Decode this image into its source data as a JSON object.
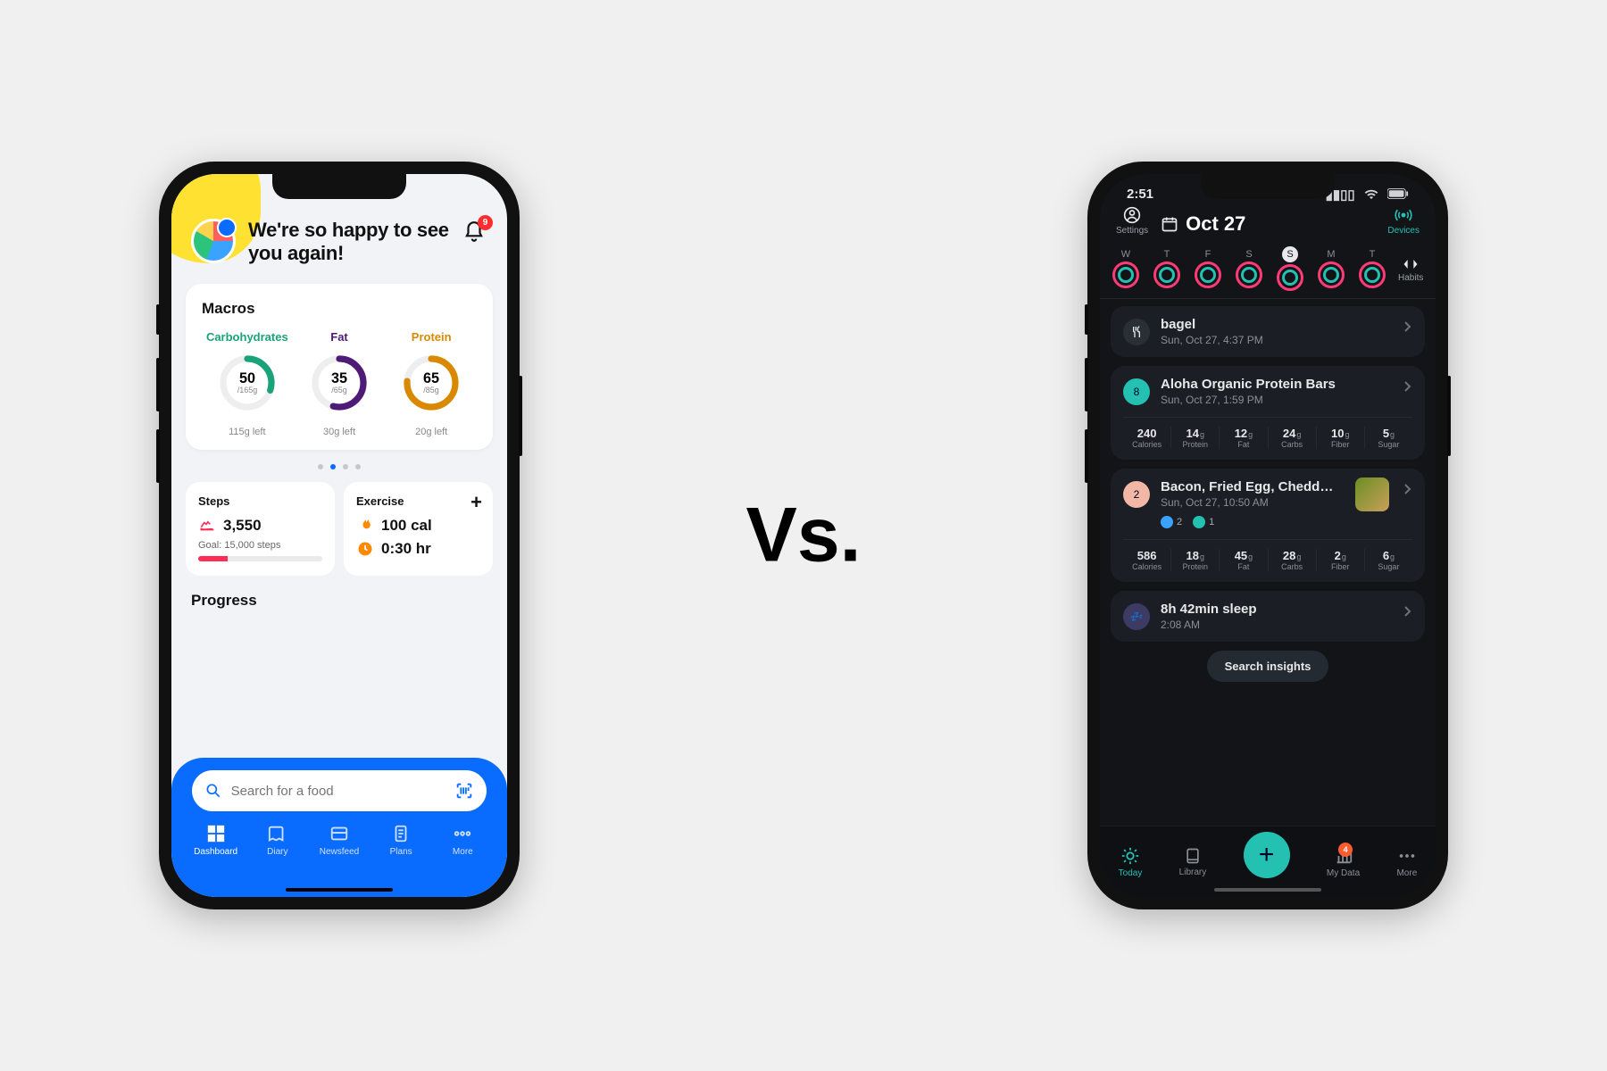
{
  "vs_text": "Vs.",
  "left": {
    "greeting": "We're so happy to see you again!",
    "notif_count": "9",
    "macros": {
      "title": "Macros",
      "items": [
        {
          "label": "Carbohydrates",
          "value": "50",
          "total": "/165g",
          "left": "115g left",
          "color": "#1aa37a",
          "pct": 30
        },
        {
          "label": "Fat",
          "value": "35",
          "total": "/65g",
          "left": "30g left",
          "color": "#4d1a77",
          "pct": 54
        },
        {
          "label": "Protein",
          "value": "65",
          "total": "/85g",
          "left": "20g left",
          "color": "#d98900",
          "pct": 76
        }
      ]
    },
    "steps": {
      "title": "Steps",
      "value": "3,550",
      "goal": "Goal: 15,000 steps",
      "pct": 24
    },
    "exercise": {
      "title": "Exercise",
      "cal": "100 cal",
      "time": "0:30 hr"
    },
    "progress_title": "Progress",
    "search_placeholder": "Search for a food",
    "tabs": [
      "Dashboard",
      "Diary",
      "Newsfeed",
      "Plans",
      "More"
    ]
  },
  "right": {
    "time": "2:51",
    "settings": "Settings",
    "devices": "Devices",
    "date": "Oct 27",
    "week_days": [
      "W",
      "T",
      "F",
      "S",
      "S",
      "M",
      "T"
    ],
    "selected_index": 4,
    "habits": "Habits",
    "items": [
      {
        "kind": "simple",
        "title": "bagel",
        "sub": "Sun, Oct 27, 4:37 PM",
        "icon": "utensils"
      },
      {
        "kind": "nutri",
        "badge_text": "8",
        "badge_color": "#24c1b3",
        "title": "Aloha Organic Protein Bars",
        "sub": "Sun, Oct 27, 1:59 PM",
        "cal": "240",
        "protein": "14",
        "fat": "12",
        "carbs": "24",
        "fiber": "10",
        "sugar": "5"
      },
      {
        "kind": "nutri",
        "badge_text": "2",
        "badge_color": "#f2b8a5",
        "title": "Bacon, Fried Egg, Chedd…",
        "sub": "Sun, Oct 27, 10:50 AM",
        "react1": "2",
        "react2": "1",
        "has_thumb": true,
        "cal": "586",
        "protein": "18",
        "fat": "45",
        "carbs": "28",
        "fiber": "2",
        "sugar": "6"
      },
      {
        "kind": "sleep",
        "title": "8h 42min sleep",
        "sub": "2:08 AM"
      }
    ],
    "nutri_labels": {
      "cal": "Calories",
      "protein": "Protein",
      "fat": "Fat",
      "carbs": "Carbs",
      "fiber": "Fiber",
      "sugar": "Sugar"
    },
    "search_insights": "Search insights",
    "tabs": [
      "Today",
      "Library",
      "",
      "My Data",
      "More"
    ],
    "mydata_badge": "4"
  }
}
